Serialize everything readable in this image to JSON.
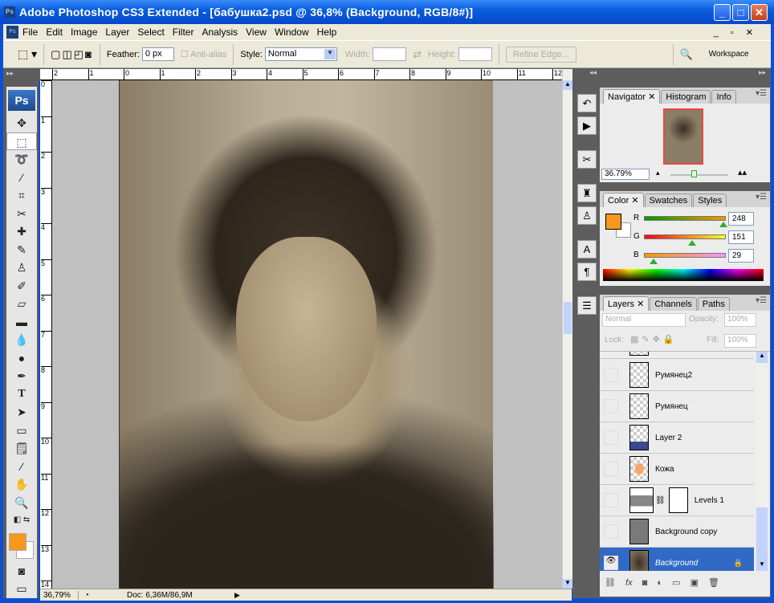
{
  "window": {
    "title": "Adobe Photoshop CS3 Extended - [бабушка2.psd @ 36,8% (Background, RGB/8#)]",
    "app_icon": "Ps"
  },
  "menu": [
    "File",
    "Edit",
    "Image",
    "Layer",
    "Select",
    "Filter",
    "Analysis",
    "View",
    "Window",
    "Help"
  ],
  "options": {
    "feather_label": "Feather:",
    "feather_value": "0 px",
    "antialias_label": "Anti-alias",
    "style_label": "Style:",
    "style_value": "Normal",
    "width_label": "Width:",
    "height_label": "Height:",
    "refine_edge": "Refine Edge...",
    "workspace": "Workspace"
  },
  "toolbox": {
    "logo": "Ps"
  },
  "rulers": {
    "top": [
      "2",
      "1",
      "0",
      "1",
      "2",
      "3",
      "4",
      "5",
      "6",
      "7",
      "8",
      "9",
      "10",
      "11",
      "12"
    ],
    "left": [
      "0",
      "1",
      "2",
      "3",
      "4",
      "5",
      "6",
      "7",
      "8",
      "9",
      "10",
      "11",
      "12",
      "13",
      "14"
    ]
  },
  "status": {
    "zoom": "36,79%",
    "doc": "Doc: 6,36M/86,9M"
  },
  "navigator": {
    "tabs": [
      "Navigator",
      "Histogram",
      "Info"
    ],
    "zoom": "36.79%"
  },
  "color": {
    "tabs": [
      "Color",
      "Swatches",
      "Styles"
    ],
    "r_label": "R",
    "g_label": "G",
    "b_label": "B",
    "r": "248",
    "g": "151",
    "b": "29",
    "foreground": "#f8971d",
    "background": "#ffffff"
  },
  "layers": {
    "tabs": [
      "Layers",
      "Channels",
      "Paths"
    ],
    "blend_mode": "Normal",
    "opacity_label": "Opacity:",
    "opacity": "100%",
    "lock_label": "Lock:",
    "fill_label": "Fill:",
    "fill": "100%",
    "items": [
      {
        "name": "Румянец2"
      },
      {
        "name": "Румянец"
      },
      {
        "name": "Layer 2"
      },
      {
        "name": "Кожа"
      },
      {
        "name": "Levels 1"
      },
      {
        "name": "Background copy"
      },
      {
        "name": "Background"
      }
    ]
  },
  "colors": {
    "accent": "#316ac5",
    "title_bar": "#0a5ee0"
  }
}
